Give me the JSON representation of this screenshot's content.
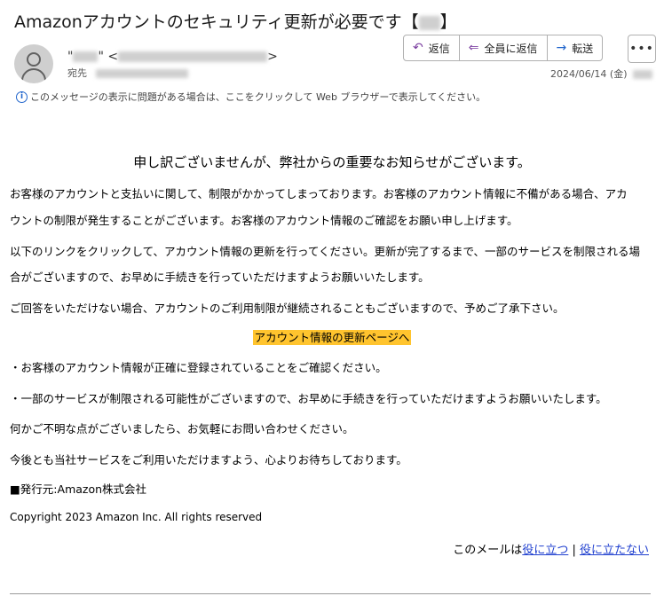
{
  "header": {
    "subject": "Amazonアカウントのセキュリティ更新が必要です【",
    "subject_end": "】",
    "sender_prefix": "\"",
    "sender_mid": "\" <",
    "sender_suffix": ">",
    "to_label": "宛先",
    "date": "2024/06/14 (金)",
    "info_text": "このメッセージの表示に問題がある場合は、ここをクリックして Web ブラウザーで表示してください。"
  },
  "actions": {
    "reply": "返信",
    "reply_all": "全員に返信",
    "forward": "転送",
    "more": "•••"
  },
  "icons": {
    "reply": "reply-icon",
    "reply_all": "reply-all-icon",
    "forward": "forward-arrow-icon",
    "more": "more-icon",
    "info": "info-icon",
    "avatar": "person-icon"
  },
  "body": {
    "headline": "申し訳ございませんが、弊社からの重要なお知らせがございます。",
    "p1a": "お客様のアカウントと支払いに関して、制限がかかってしまっております。お客様のアカウント情報に不備がある場合、アカ",
    "p1b": "ウントの制限が発生することがございます。お客様のアカウント情報のご確認をお願い申し上げます。",
    "p2a": "以下のリンクをクリックして、アカウント情報の更新を行ってください。更新が完了するまで、一部のサービスを制限される場",
    "p2b": "合がございますので、お早めに手続きを行っていただけますようお願いいたします。",
    "p3": "ご回答をいただけない場合、アカウントのご利用制限が継続されることもございますので、予めご了承下さい。",
    "link": "アカウント情報の更新ページへ",
    "bullet1": "・お客様のアカウント情報が正確に登録されていることをご確認ください。",
    "bullet2": "・一部のサービスが制限される可能性がございますので、お早めに手続きを行っていただけますようお願いいたします。",
    "p4": "何かご不明な点がございましたら、お気軽にお問い合わせください。",
    "p5": "今後とも当社サービスをご利用いただけますよう、心よりお待ちしております。",
    "issuer": "■発行元:Amazon株式会社",
    "copyright": "Copyright 2023 Amazon Inc. All rights reserved"
  },
  "footer": {
    "prefix": "このメールは",
    "helpful": "役に立つ",
    "separator": " | ",
    "not_helpful": "役に立たない"
  },
  "colors": {
    "accent": "#7b3fa0",
    "link": "#1f3fcf",
    "highlight": "#ffc42e"
  }
}
